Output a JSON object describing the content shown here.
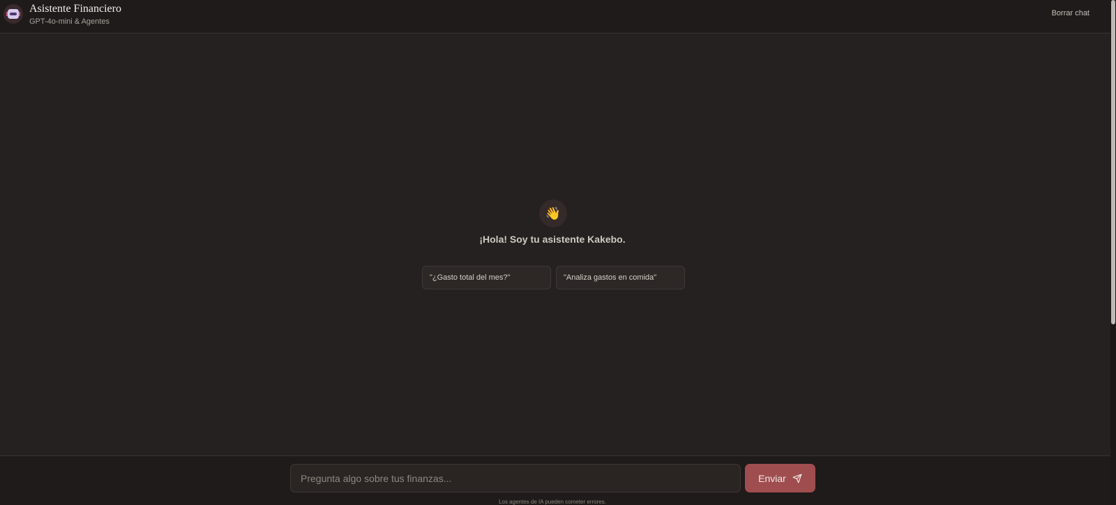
{
  "header": {
    "title": "Asistente Financiero",
    "subtitle": "GPT-4o-mini & Agentes",
    "clear_label": "Borrar chat",
    "avatar_icon": "robot-icon"
  },
  "welcome": {
    "icon": "waving-hand-icon",
    "emoji": "👋",
    "message": "¡Hola! Soy tu asistente Kakebo.",
    "suggestions": [
      "\"¿Gasto total del mes?\"",
      "\"Analiza gastos en comida\""
    ]
  },
  "composer": {
    "placeholder": "Pregunta algo sobre tus finanzas...",
    "value": "",
    "send_label": "Enviar",
    "send_icon": "send-icon",
    "disclaimer": "Los agentes de IA pueden cometer errores."
  },
  "colors": {
    "background": "#252120",
    "header": "#1f1b1a",
    "accent": "#a04d4f"
  }
}
